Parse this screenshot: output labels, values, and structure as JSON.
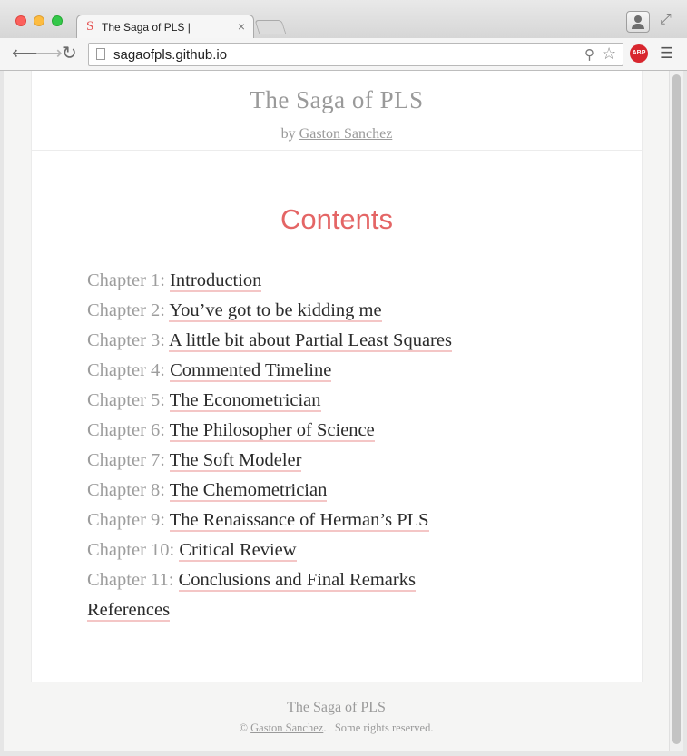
{
  "browser": {
    "tab_title": "The Saga of PLS |",
    "tab_favicon": "S",
    "tab_close": "×",
    "url": "sagaofpls.github.io",
    "adblock_badge": "ABP",
    "icons": [
      "back-arrow-icon",
      "forward-arrow-icon",
      "reload-icon",
      "page-icon",
      "search-icon",
      "star-icon",
      "abp-icon",
      "menu-icon",
      "profile-icon",
      "fullscreen-icon"
    ]
  },
  "site": {
    "title": "The Saga of PLS",
    "byline_prefix": "by",
    "author": "Gaston Sanchez"
  },
  "contents": {
    "heading": "Contents",
    "items": [
      {
        "number": "Chapter 1:",
        "title": "Introduction"
      },
      {
        "number": "Chapter 2:",
        "title": "You’ve got to be kidding me"
      },
      {
        "number": "Chapter 3:",
        "title": "A little bit about Partial Least Squares"
      },
      {
        "number": "Chapter 4:",
        "title": "Commented Timeline"
      },
      {
        "number": "Chapter 5:",
        "title": "The Econometrician"
      },
      {
        "number": "Chapter 6:",
        "title": "The Philosopher of Science"
      },
      {
        "number": "Chapter 7:",
        "title": "The Soft Modeler"
      },
      {
        "number": "Chapter 8:",
        "title": "The Chemometrician"
      },
      {
        "number": "Chapter 9:",
        "title": "The Renaissance of Herman’s PLS"
      },
      {
        "number": "Chapter 10:",
        "title": "Critical Review"
      },
      {
        "number": "Chapter 11:",
        "title": "Conclusions and Final Remarks"
      },
      {
        "number": "",
        "title": "References"
      }
    ]
  },
  "footer": {
    "title": "The Saga of PLS",
    "copyright_symbol": "©",
    "author": "Gaston Sanchez",
    "rights": "Some rights reserved."
  },
  "colors": {
    "accent": "#e46565",
    "link_underline": "#f4c6c6",
    "muted_text": "#9a9a9a"
  }
}
